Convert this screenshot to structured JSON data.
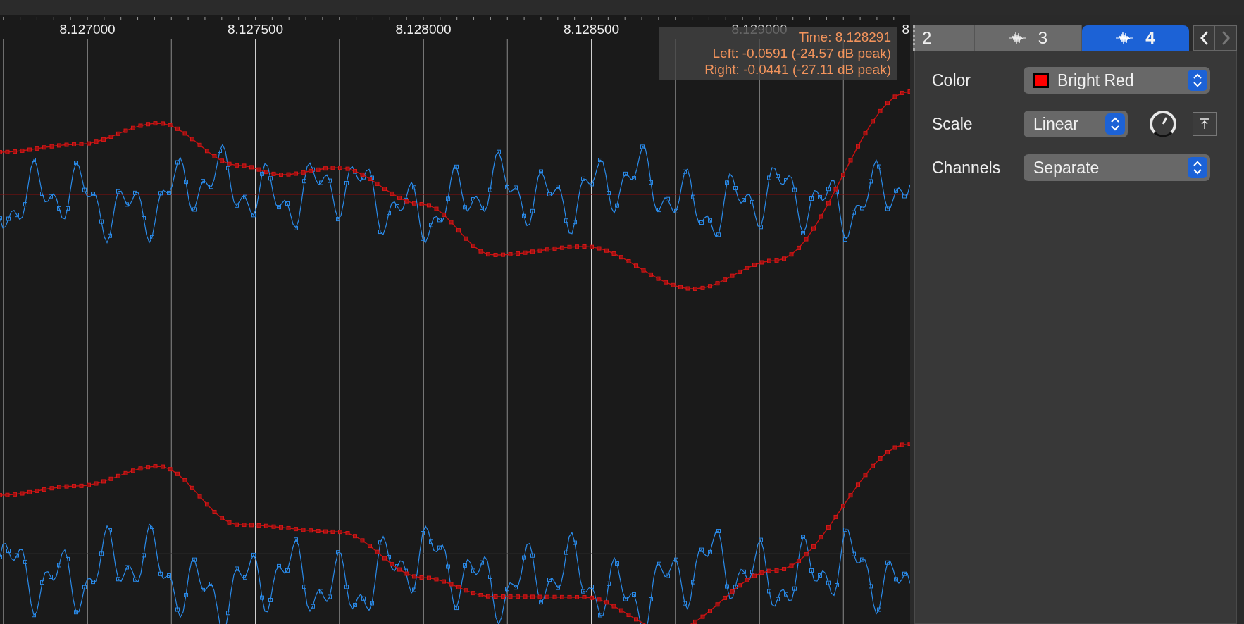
{
  "ruler": {
    "labels": [
      "8.127000",
      "8.127500",
      "8.128000",
      "8.128500",
      "8.129000",
      "8"
    ]
  },
  "tooltip": {
    "lines": [
      "Time: 8.128291",
      "Left: -0.0591 (-24.57 dB peak)",
      "Right: -0.0441 (-27.11 dB peak)"
    ]
  },
  "tabs": [
    {
      "label": "2",
      "kind": "cut",
      "selected": false
    },
    {
      "label": "3",
      "kind": "full",
      "selected": false
    },
    {
      "label": "4",
      "kind": "full",
      "selected": true
    }
  ],
  "nav": [
    {
      "kind": "prev",
      "disabled": false
    },
    {
      "kind": "next",
      "disabled": true
    }
  ],
  "settings": [
    {
      "label": "Color",
      "kind": "color",
      "value": "Bright Red",
      "color": "#ff0000"
    },
    {
      "label": "Scale",
      "kind": "scale",
      "value": "Linear"
    },
    {
      "label": "Channels",
      "kind": "plain",
      "value": "Separate"
    }
  ]
}
